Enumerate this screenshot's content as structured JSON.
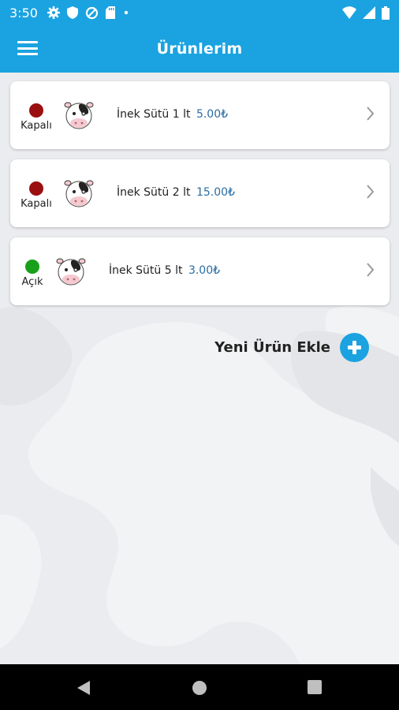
{
  "status_bar": {
    "time": "3:50",
    "left_icons": [
      "gear-icon",
      "shield-icon",
      "data-saver-icon",
      "sd-card-icon",
      "notification-dot-icon"
    ],
    "right_icons": [
      "wifi-icon",
      "signal-icon",
      "battery-icon"
    ]
  },
  "app_bar": {
    "title": "Ürünlerim",
    "menu_icon": "hamburger-menu-icon",
    "color": "#1aa3e0"
  },
  "products": [
    {
      "status": "Kapalı",
      "status_color": "#9a0f0f",
      "name": "İnek Sütü 1 lt",
      "price": "5.00₺"
    },
    {
      "status": "Kapalı",
      "status_color": "#9a0f0f",
      "name": "İnek Sütü 2 lt",
      "price": "15.00₺"
    },
    {
      "status": "Açık",
      "status_color": "#18a01a",
      "name": "İnek Sütü 5 lt",
      "price": "3.00₺"
    }
  ],
  "add_product": {
    "label": "Yeni Ürün Ekle",
    "icon": "plus-circle-icon"
  },
  "nav_bar": {
    "icons": [
      "back-icon",
      "home-icon",
      "recents-icon"
    ]
  }
}
